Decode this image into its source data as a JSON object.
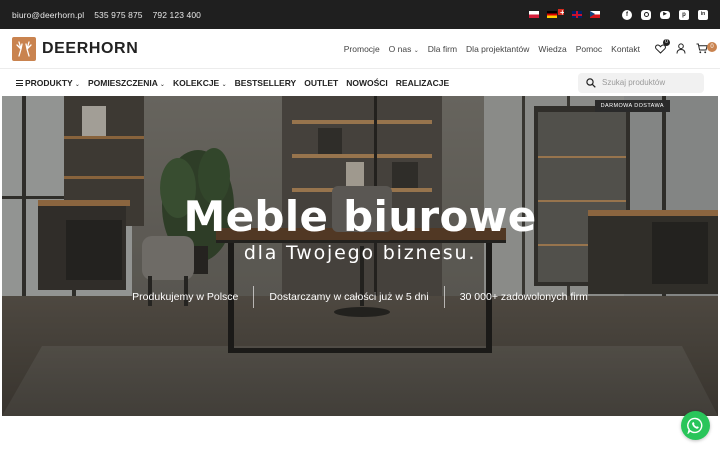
{
  "topbar": {
    "email": "biuro@deerhorn.pl",
    "phone1": "535 975 875",
    "phone2": "792 123 400",
    "languages": [
      "pl-flag-icon",
      "de-flag-icon",
      "ch-flag-icon",
      "gb-flag-icon",
      "cz-flag-icon"
    ],
    "social": [
      "facebook-icon",
      "instagram-icon",
      "youtube-icon",
      "pinterest-icon",
      "linkedin-icon"
    ]
  },
  "header": {
    "logo_text": "DEERHORN",
    "nav": {
      "promocje": "Promocje",
      "o_nas": "O nas",
      "dla_firm": "Dla firm",
      "dla_projektantow": "Dla projektantów",
      "wiedza": "Wiedza",
      "pomoc": "Pomoc",
      "kontakt": "Kontakt"
    },
    "wishlist_count": "0",
    "cart_count": "0"
  },
  "categories": {
    "produkty": "PRODUKTY",
    "pomieszczenia": "POMIESZCZENIA",
    "kolekcje": "KOLEKCJE",
    "bestsellery": "BESTSELLERY",
    "outlet": "OUTLET",
    "nowosci": "NOWOŚCI",
    "realizacje": "REALIZACJE"
  },
  "search": {
    "placeholder": "Szukaj produktów"
  },
  "hero": {
    "ribbon": "DARMOWA DOSTAWA",
    "title": "Meble biurowe",
    "subtitle": "dla Twojego biznesu.",
    "features": [
      "Produkujemy w Polsce",
      "Dostarczamy w całości już w 5 dni",
      "30 000+ zadowolonych firm"
    ]
  },
  "colors": {
    "accent": "#c9834f",
    "topbar": "#1f1f1f",
    "whatsapp": "#29c55a"
  }
}
